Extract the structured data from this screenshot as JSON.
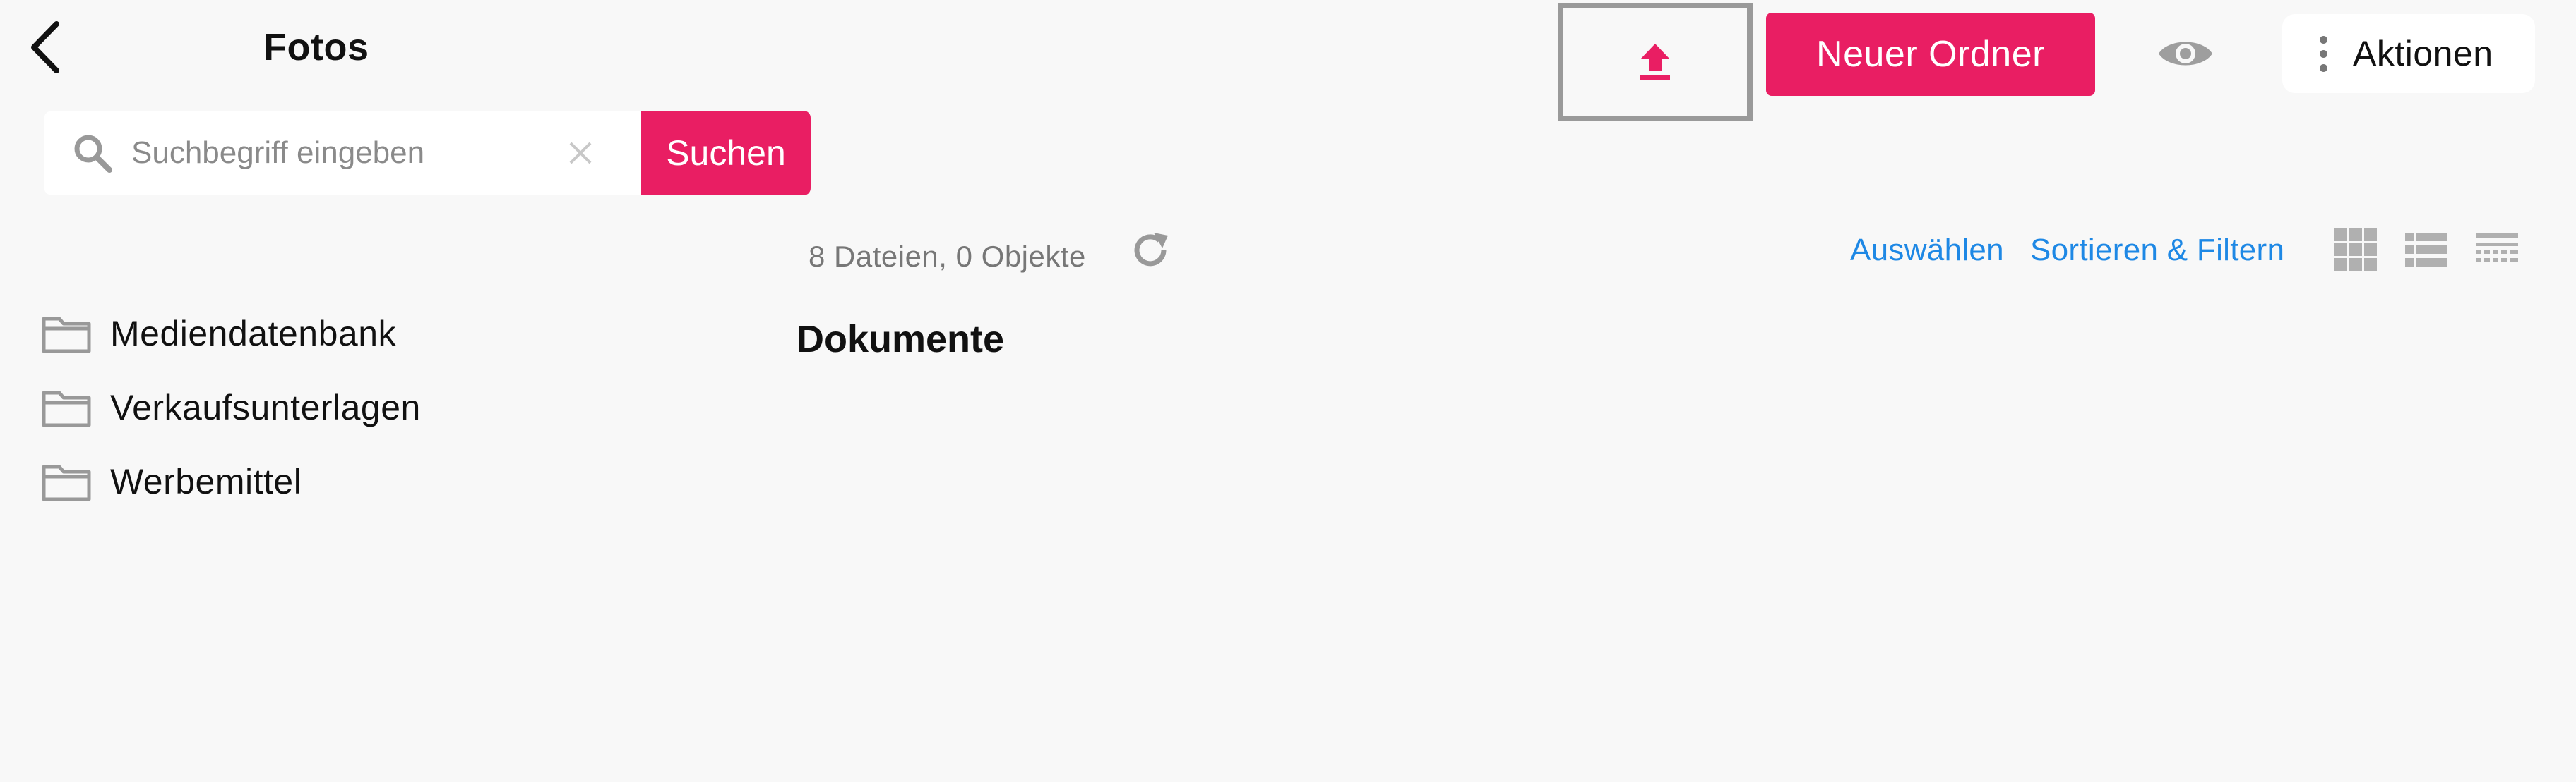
{
  "header": {
    "title": "Fotos",
    "new_folder_label": "Neuer Ordner",
    "actions_label": "Aktionen"
  },
  "search": {
    "placeholder": "Suchbegriff eingeben",
    "value": "",
    "button_label": "Suchen"
  },
  "sidebar": {
    "folders": [
      {
        "label": "Mediendatenbank"
      },
      {
        "label": "Verkaufsunterlagen"
      },
      {
        "label": "Werbemittel"
      }
    ]
  },
  "content": {
    "file_count": "8 Dateien, 0 Objekte",
    "section_title": "Dokumente",
    "select_label": "Auswählen",
    "sort_filter_label": "Sortieren & Filtern"
  },
  "icons": {
    "back": "chevron-left-icon",
    "upload": "upload-icon",
    "view": "eye-icon",
    "more": "more-vertical-icon",
    "search": "search-icon",
    "clear": "close-icon",
    "folder": "folder-icon",
    "refresh": "refresh-icon",
    "grid_view": "grid-view-icon",
    "list_view": "list-view-icon",
    "table_view": "table-view-icon"
  },
  "colors": {
    "accent": "#e91e63",
    "link": "#1e88e5",
    "background": "#f8f8f8",
    "icon_gray": "#9e9e9e"
  }
}
